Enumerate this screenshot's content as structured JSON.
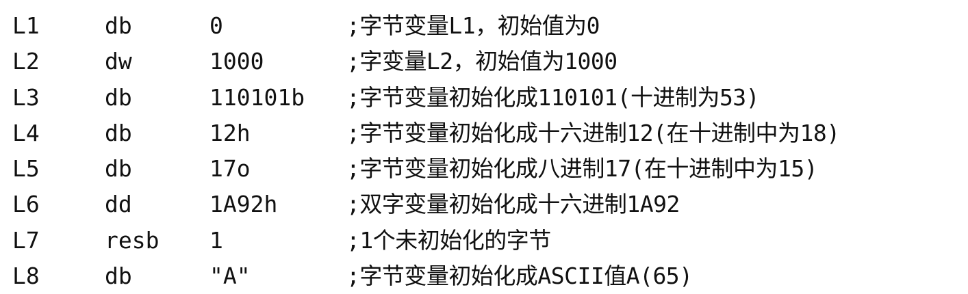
{
  "lines": [
    {
      "label": "L1",
      "directive": "db",
      "value": "0",
      "comment": ";字节变量L1，初始值为0"
    },
    {
      "label": "L2",
      "directive": "dw",
      "value": "1000",
      "comment": ";字变量L2，初始值为1000"
    },
    {
      "label": "L3",
      "directive": "db",
      "value": "110101b",
      "comment": ";字节变量初始化成110101(十进制为53)"
    },
    {
      "label": "L4",
      "directive": "db",
      "value": "12h",
      "comment": ";字节变量初始化成十六进制12(在十进制中为18)"
    },
    {
      "label": "L5",
      "directive": "db",
      "value": "17o",
      "comment": ";字节变量初始化成八进制17(在十进制中为15)"
    },
    {
      "label": "L6",
      "directive": "dd",
      "value": "1A92h",
      "comment": ";双字变量初始化成十六进制1A92"
    },
    {
      "label": "L7",
      "directive": "resb",
      "value": "1",
      "comment": ";1个未初始化的字节"
    },
    {
      "label": "L8",
      "directive": "db",
      "value": "\"A\"",
      "comment": ";字节变量初始化成ASCII值A(65)"
    }
  ]
}
